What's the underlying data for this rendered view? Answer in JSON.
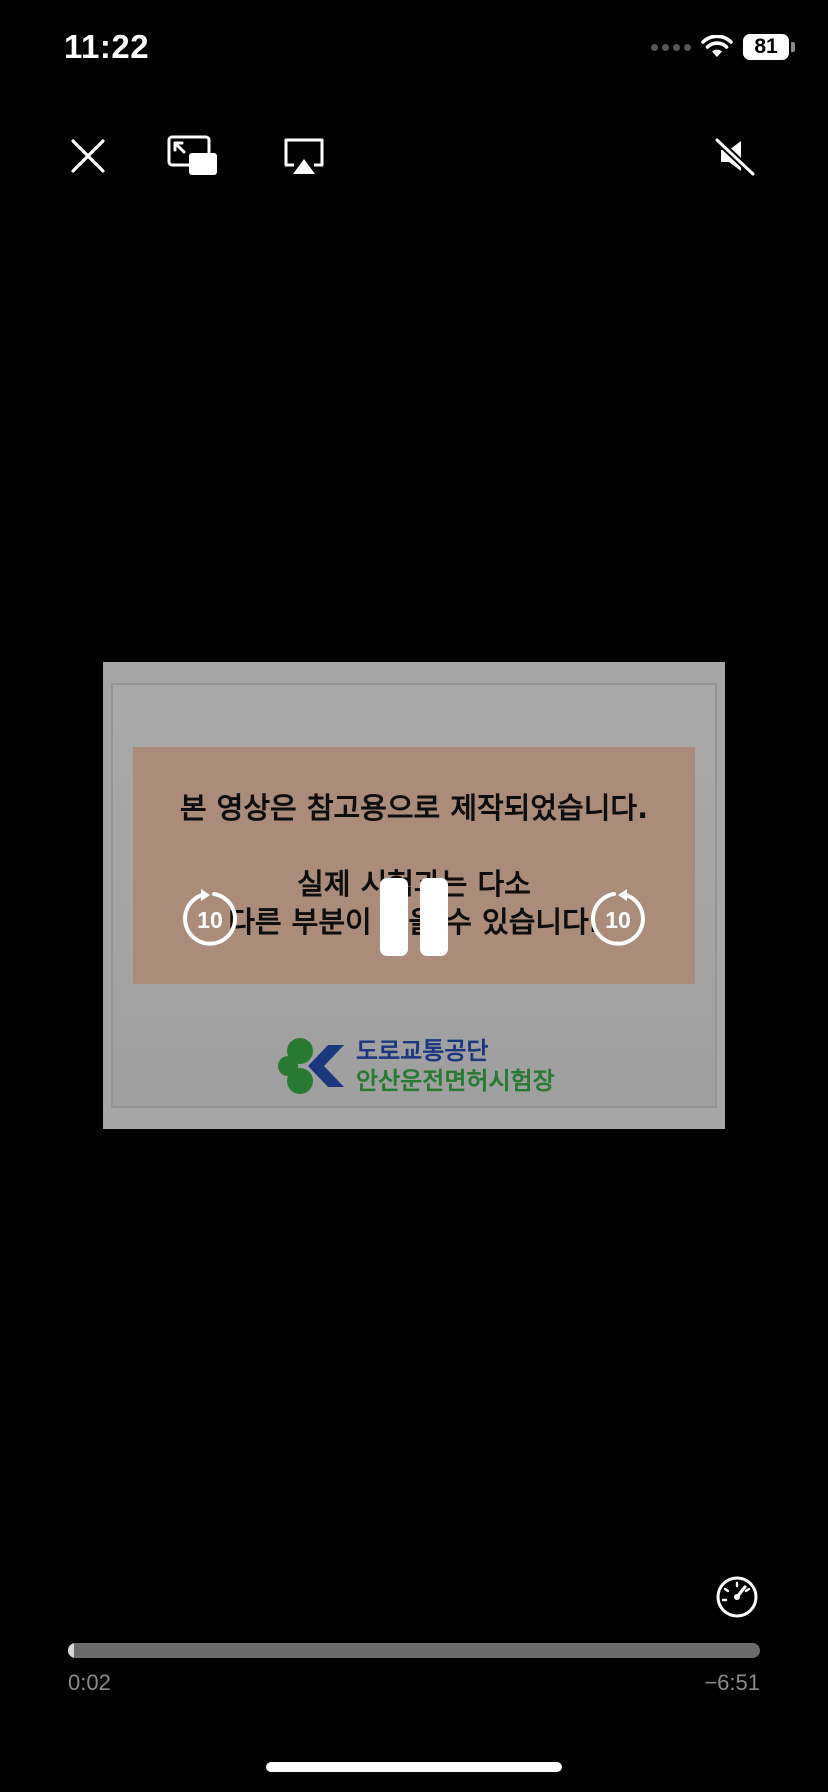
{
  "status_bar": {
    "time": "11:22",
    "battery_level": "81",
    "icons": [
      "cellular-signal-icon",
      "wifi-icon",
      "battery-icon"
    ]
  },
  "top_controls": {
    "icons": [
      "close-icon",
      "picture-in-picture-icon",
      "airplay-icon",
      "muted-speaker-icon"
    ]
  },
  "video": {
    "banner_line1": "본 영상은 참고용으로 제작되었습니다.",
    "banner_line2": "실제 시험과는 다소",
    "banner_line3": "다른 부분이 있을 수 있습니다.",
    "logo_line1": "도로교통공단",
    "logo_line2": "안산운전면허시험장",
    "colors": {
      "banner": "#c3a08c",
      "logo_blue": "#1f3f8f",
      "logo_green": "#2e8b3a"
    }
  },
  "playback": {
    "skip_back_seconds": "10",
    "skip_forward_seconds": "10",
    "state": "playing",
    "icons": [
      "skip-back-10-icon",
      "pause-icon",
      "skip-forward-10-icon",
      "playback-speed-icon"
    ]
  },
  "timeline": {
    "elapsed": "0:02",
    "remaining": "−6:51",
    "progress_fraction": 0.005
  }
}
